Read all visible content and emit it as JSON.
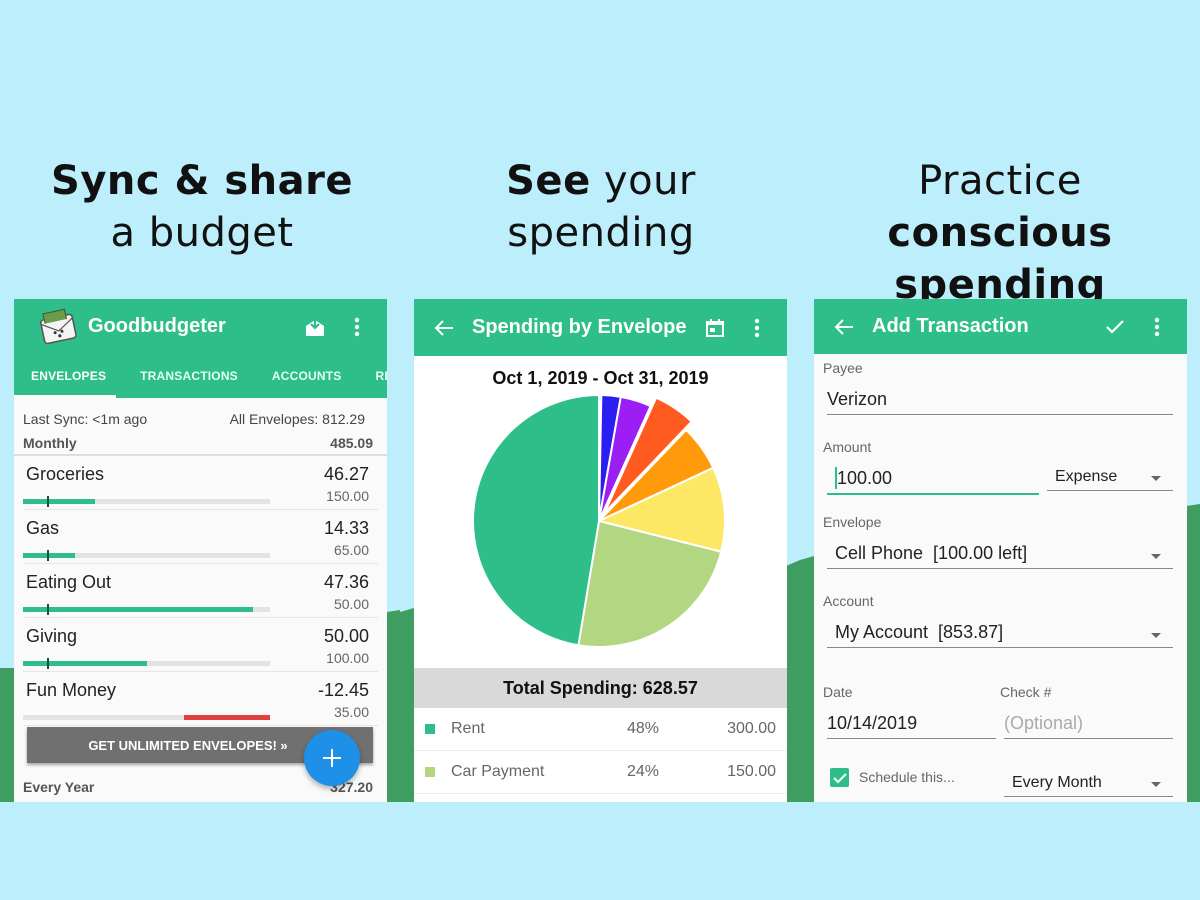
{
  "headlines": [
    {
      "line1_bold": "Sync & share",
      "line2": "a budget"
    },
    {
      "line1_bold": "See",
      "line1_light": " your",
      "line2": "spending"
    },
    {
      "line1_light": "Practice ",
      "line1_bold": "conscious",
      "line2_bold": "spending"
    }
  ],
  "colors": {
    "background": "#bdeefb",
    "hills": "#3f9e5f",
    "accent": "#2ebe8a",
    "fab": "#1e90e8",
    "negative": "#e04040"
  },
  "envelopes_screen": {
    "app_title": "Goodbudgeter",
    "icons": [
      "app-logo-envelope-icon",
      "inbox-download-icon",
      "more-vert-icon"
    ],
    "tabs": [
      {
        "label": "ENVELOPES",
        "active": true
      },
      {
        "label": "TRANSACTIONS",
        "active": false
      },
      {
        "label": "ACCOUNTS",
        "active": false
      },
      {
        "label": "REPO",
        "active": false
      }
    ],
    "last_sync": "Last Sync: <1m ago",
    "all_envelopes": "All Envelopes: 812.29",
    "group_monthly": {
      "label": "Monthly",
      "total": "485.09"
    },
    "envelopes": [
      {
        "name": "Groceries",
        "amount": "46.27",
        "budget": "150.00",
        "fill_fraction": 0.29,
        "negative": false
      },
      {
        "name": "Gas",
        "amount": "14.33",
        "budget": "65.00",
        "fill_fraction": 0.21,
        "negative": false
      },
      {
        "name": "Eating Out",
        "amount": "47.36",
        "budget": "50.00",
        "fill_fraction": 0.93,
        "negative": false
      },
      {
        "name": "Giving",
        "amount": "50.00",
        "budget": "100.00",
        "fill_fraction": 0.5,
        "negative": false
      },
      {
        "name": "Fun Money",
        "amount": "-12.45",
        "budget": "35.00",
        "fill_fraction": 0.35,
        "negative": true
      }
    ],
    "upsell_button": "GET UNLIMITED ENVELOPES! »",
    "fab_icon": "plus-icon",
    "group_yearly": {
      "label": "Every Year",
      "total": "327.20"
    }
  },
  "spending_screen": {
    "title": "Spending by Envelope",
    "icons": [
      "back-arrow-icon",
      "calendar-icon",
      "more-vert-icon"
    ],
    "date_range": "Oct 1, 2019 - Oct 31, 2019",
    "total_spending": "Total Spending: 628.57",
    "legend": [
      {
        "name": "Rent",
        "percent": "48%",
        "value": "300.00",
        "color": "#2ebe8a"
      },
      {
        "name": "Car Payment",
        "percent": "24%",
        "value": "150.00",
        "color": "#b3d683"
      }
    ]
  },
  "chart_data": {
    "type": "pie",
    "title": "Oct 1, 2019 - Oct 31, 2019",
    "total": 628.57,
    "slices": [
      {
        "label": "Rent",
        "value": 300.0,
        "percent": 48,
        "color": "#2ebe8a"
      },
      {
        "label": "Car Payment",
        "value": 150.0,
        "percent": 24,
        "color": "#b3d683"
      },
      {
        "label": "(unlabeled)",
        "percent": 11,
        "color": "#fde866"
      },
      {
        "label": "(unlabeled)",
        "percent": 6,
        "color": "#ff9a0a",
        "exploded": false
      },
      {
        "label": "(unlabeled)",
        "percent": 5.5,
        "color": "#ff5a1f",
        "exploded": true
      },
      {
        "label": "(unlabeled)",
        "percent": 4,
        "color": "#9b1ff5"
      },
      {
        "label": "(unlabeled)",
        "percent": 2.5,
        "color": "#2a1ff0"
      },
      {
        "label": "(unlabeled)",
        "percent": 0.3,
        "color": "#6fd3ff"
      }
    ]
  },
  "add_transaction_screen": {
    "title": "Add Transaction",
    "icons": [
      "back-arrow-icon",
      "check-icon",
      "more-vert-icon"
    ],
    "payee": {
      "label": "Payee",
      "value": "Verizon"
    },
    "amount": {
      "label": "Amount",
      "value": "100.00"
    },
    "type": {
      "selected": "Expense"
    },
    "envelope": {
      "label": "Envelope",
      "selected": "Cell Phone  [100.00 left]"
    },
    "account": {
      "label": "Account",
      "selected": "My Account  [853.87]"
    },
    "date": {
      "label": "Date",
      "value": "10/14/2019"
    },
    "check": {
      "label": "Check #",
      "placeholder": "(Optional)"
    },
    "schedule": {
      "label": "Schedule this...",
      "checked": true,
      "frequency": "Every Month"
    }
  }
}
